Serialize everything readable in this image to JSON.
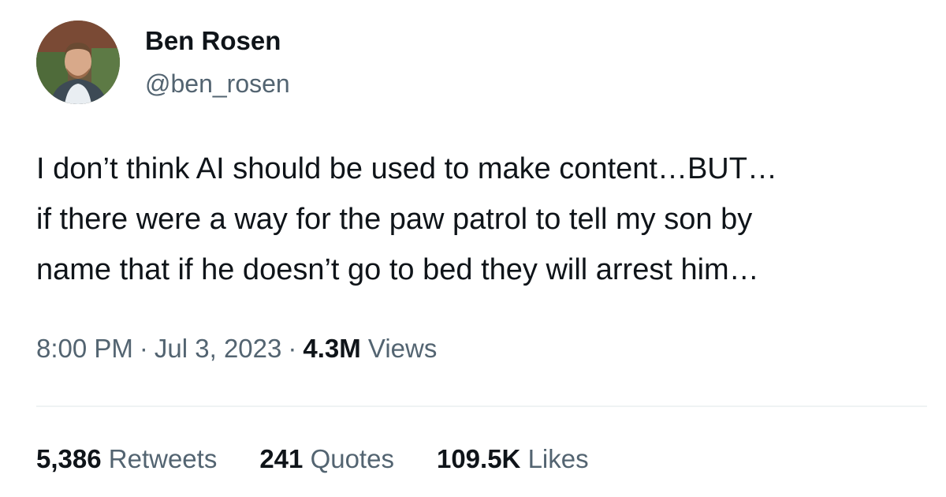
{
  "author": {
    "display_name": "Ben Rosen",
    "handle": "@ben_rosen"
  },
  "tweet": {
    "lines": [
      "I don’t think AI should be used to make content…BUT…",
      "if there were a way for the paw patrol to tell my son by",
      "name that if he doesn’t go to bed they will arrest him…"
    ],
    "time": "8:00 PM",
    "date": "Jul 3, 2023",
    "separator": "·",
    "views_count": "4.3M",
    "views_label": "Views"
  },
  "stats": {
    "retweets_count": "5,386",
    "retweets_label": "Retweets",
    "quotes_count": "241",
    "quotes_label": "Quotes",
    "likes_count": "109.5K",
    "likes_label": "Likes"
  },
  "colors": {
    "text_primary": "#0f1419",
    "text_secondary": "#536471",
    "divider": "#eff3f4"
  }
}
